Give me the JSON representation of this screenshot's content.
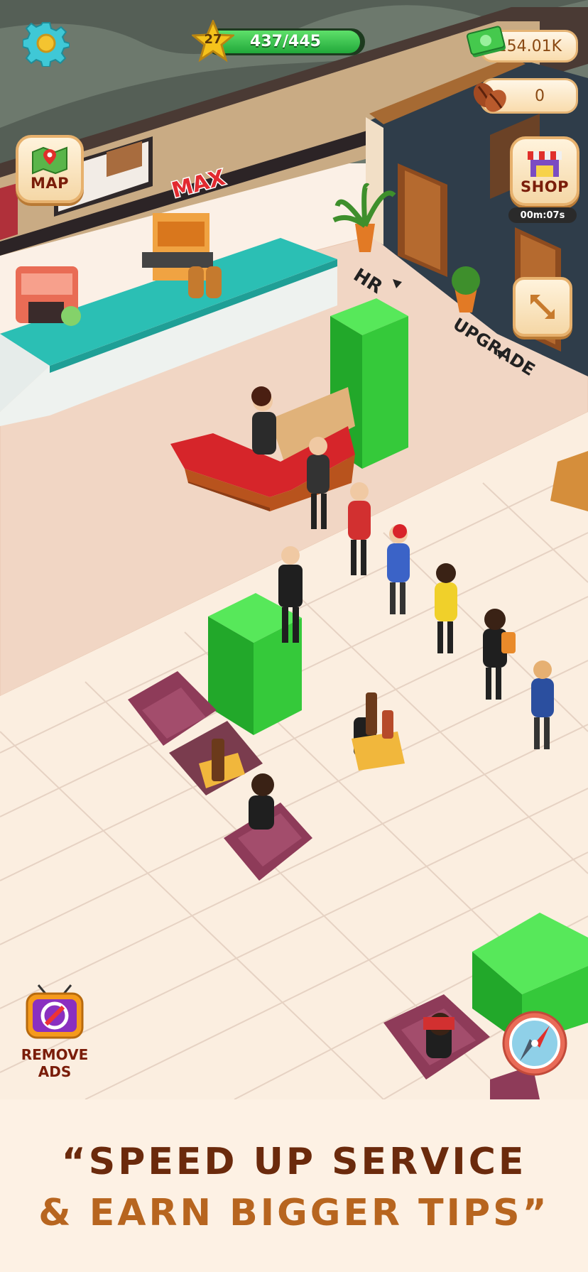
{
  "hud": {
    "level": "27",
    "xp_progress_text": "437/445",
    "xp_progress_fraction": 0.982,
    "cash": "154.01K",
    "beans": "0",
    "map_label": "MAP",
    "shop_label": "SHOP",
    "shop_timer": "00m:07s",
    "remove_ads_line1": "REMOVE",
    "remove_ads_line2": "ADS"
  },
  "floor_labels": {
    "max": "MAX",
    "hr": "HR",
    "upgrade": "UPGRADE"
  },
  "tagline": {
    "line1": "“SPEED UP SERVICE",
    "line2": "& EARN BIGGER TIPS”"
  },
  "icons": {
    "settings": "gear-icon",
    "level": "star-icon",
    "cash": "cash-icon",
    "beans": "coffee-bean-icon",
    "map": "map-icon",
    "shop": "shop-icon",
    "expand": "expand-icon",
    "remove_ads": "no-ads-tv-icon",
    "compass": "compass-icon"
  },
  "colors": {
    "xp_bar": "#2ec24a",
    "cash_stack": "#3bd43a",
    "counter_top": "#d6252a",
    "tagline_dark": "#6b2a0c",
    "tagline_light": "#b7651f"
  }
}
